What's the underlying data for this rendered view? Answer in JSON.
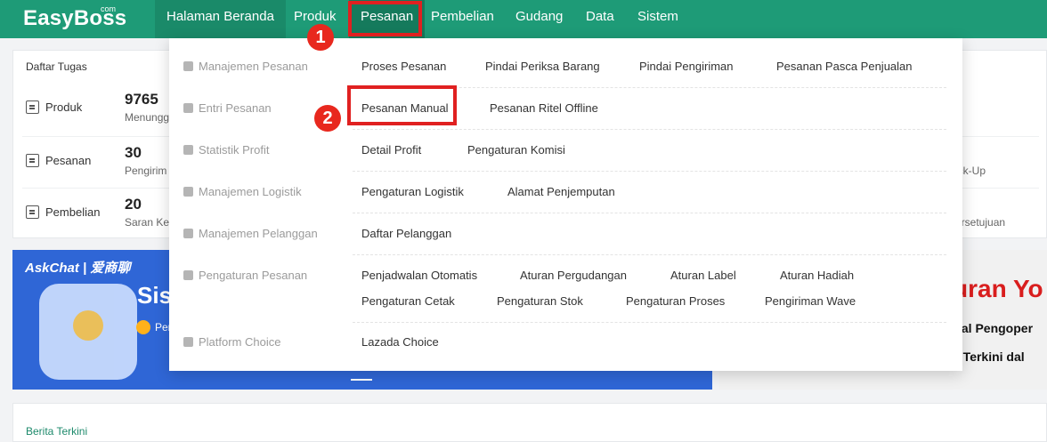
{
  "app": {
    "logo": "EasyBoss",
    "logo_suffix": "com"
  },
  "nav": {
    "items": [
      {
        "label": "Halaman Beranda"
      },
      {
        "label": "Produk"
      },
      {
        "label": "Pesanan"
      },
      {
        "label": "Pembelian"
      },
      {
        "label": "Gudang"
      },
      {
        "label": "Data"
      },
      {
        "label": "Sistem"
      }
    ]
  },
  "annotations": {
    "step1": "1",
    "step2": "2",
    "highlight_color": "#e02020"
  },
  "tasks": {
    "title": "Daftar Tugas",
    "rows": [
      {
        "label": "Produk",
        "count": "9765",
        "sub": "Menungg",
        "right": ""
      },
      {
        "label": "Pesanan",
        "count": "30",
        "sub": "Pengirim",
        "right": "ick-Up"
      },
      {
        "label": "Pembelian",
        "count": "20",
        "sub": "Saran Ke",
        "right": "ersetujuan"
      }
    ]
  },
  "banner_left": {
    "brand": "AskChat | 爱商聊",
    "headline": "Sis",
    "sub": "Pen"
  },
  "banner_right": {
    "big": "uran Yo",
    "line1": "ial Pengoper",
    "line2": "a Terkini dal"
  },
  "news": {
    "title": "Berita Terkini"
  },
  "dropdown": {
    "categories": [
      {
        "label": "Manajemen Pesanan",
        "icon": "clipboard-icon",
        "links": [
          "Proses Pesanan",
          "Pindai Periksa Barang",
          "Pindai Pengiriman",
          "Pesanan Pasca Penjualan"
        ]
      },
      {
        "label": "Entri Pesanan",
        "icon": "entry-icon",
        "links": [
          "Pesanan Manual",
          "Pesanan Ritel Offline"
        ]
      },
      {
        "label": "Statistik Profit",
        "icon": "coins-icon",
        "links": [
          "Detail Profit",
          "Pengaturan Komisi"
        ]
      },
      {
        "label": "Manajemen Logistik",
        "icon": "truck-icon",
        "links": [
          "Pengaturan Logistik",
          "Alamat Penjemputan"
        ]
      },
      {
        "label": "Manajemen Pelanggan",
        "icon": "contact-icon",
        "links": [
          "Daftar Pelanggan"
        ]
      },
      {
        "label": "Pengaturan Pesanan",
        "icon": "settings-doc-icon",
        "links": [
          "Penjadwalan Otomatis",
          "Aturan Pergudangan",
          "Aturan Label",
          "Aturan Hadiah",
          "Pengaturan Cetak",
          "Pengaturan Stok",
          "Pengaturan Proses",
          "Pengiriman Wave"
        ]
      },
      {
        "label": "Platform Choice",
        "icon": "hand-icon",
        "links": [
          "Lazada Choice"
        ]
      }
    ]
  }
}
